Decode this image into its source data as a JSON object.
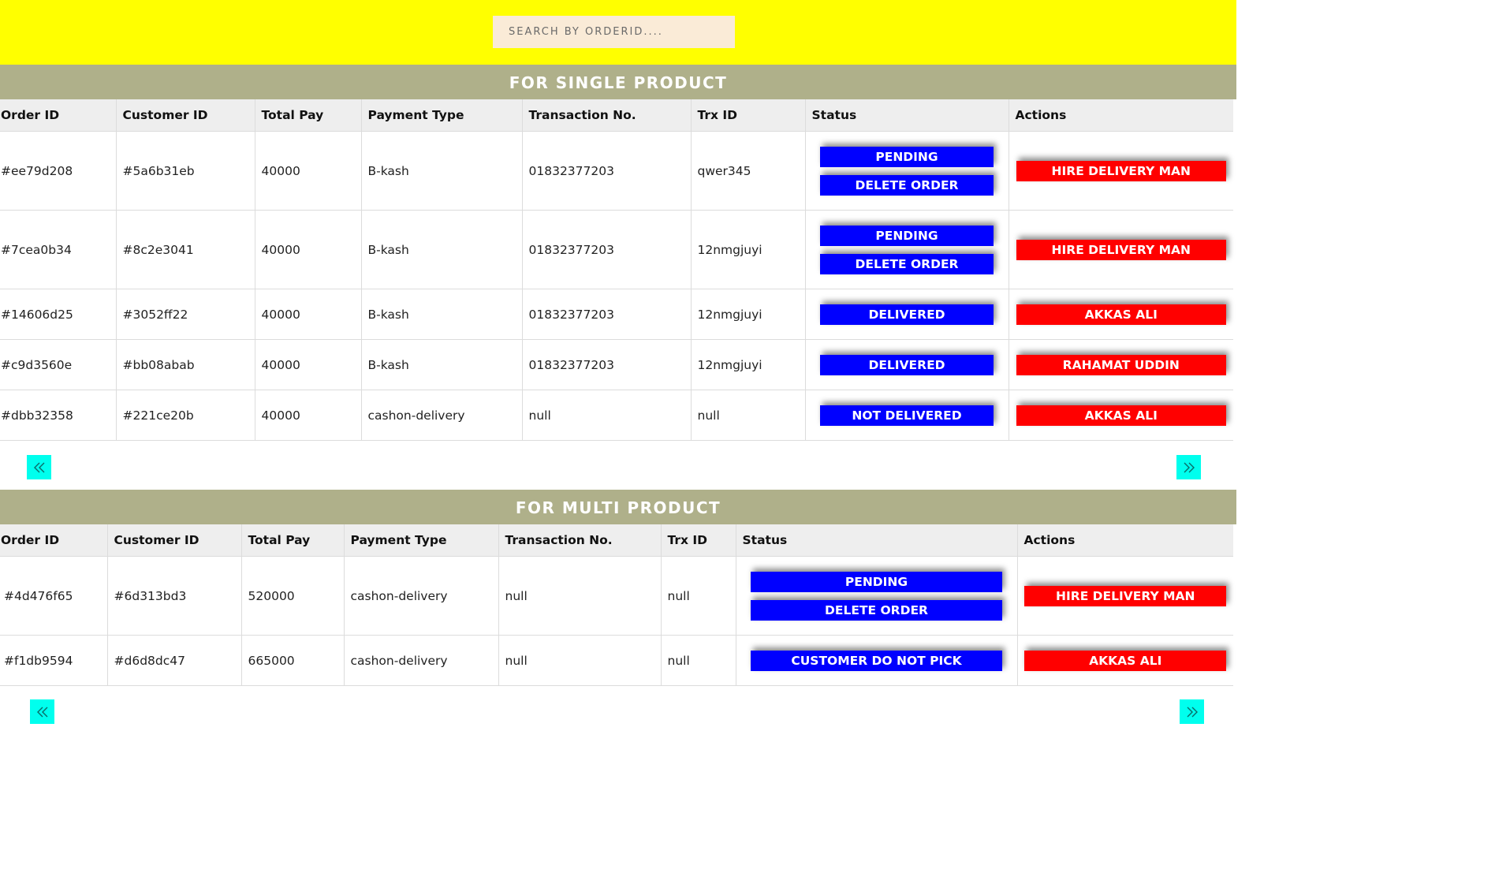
{
  "search": {
    "placeholder": "SEARCH BY ORDERID...."
  },
  "headers": [
    "Order ID",
    "Customer ID",
    "Total Pay",
    "Payment Type",
    "Transaction No.",
    "Trx ID",
    "Status",
    "Actions"
  ],
  "single": {
    "title": "FOR SINGLE PRODUCT",
    "rows": [
      {
        "order_id": "#ee79d208",
        "customer_id": "#5a6b31eb",
        "total_pay": "40000",
        "payment_type": "B-kash",
        "transaction_no": "01832377203",
        "trx_id": "qwer345",
        "status": "PENDING",
        "delete": "DELETE ORDER",
        "action": "HIRE DELIVERY MAN"
      },
      {
        "order_id": "#7cea0b34",
        "customer_id": "#8c2e3041",
        "total_pay": "40000",
        "payment_type": "B-kash",
        "transaction_no": "01832377203",
        "trx_id": "12nmgjuyi",
        "status": "PENDING",
        "delete": "DELETE ORDER",
        "action": "HIRE DELIVERY MAN"
      },
      {
        "order_id": "#14606d25",
        "customer_id": "#3052ff22",
        "total_pay": "40000",
        "payment_type": "B-kash",
        "transaction_no": "01832377203",
        "trx_id": "12nmgjuyi",
        "status": "DELIVERED",
        "action": "AKKAS ALI"
      },
      {
        "order_id": "#c9d3560e",
        "customer_id": "#bb08abab",
        "total_pay": "40000",
        "payment_type": "B-kash",
        "transaction_no": "01832377203",
        "trx_id": "12nmgjuyi",
        "status": "DELIVERED",
        "action": "RAHAMAT UDDIN"
      },
      {
        "order_id": "#dbb32358",
        "customer_id": "#221ce20b",
        "total_pay": "40000",
        "payment_type": "cashon-delivery",
        "transaction_no": "null",
        "trx_id": "null",
        "status": "NOT DELIVERED",
        "action": "AKKAS ALI"
      }
    ]
  },
  "multi": {
    "title": "FOR MULTI PRODUCT",
    "rows": [
      {
        "order_id": "#4d476f65",
        "customer_id": "#6d313bd3",
        "total_pay": "520000",
        "payment_type": "cashon-delivery",
        "transaction_no": "null",
        "trx_id": "null",
        "status": "PENDING",
        "delete": "DELETE ORDER",
        "action": "HIRE DELIVERY MAN"
      },
      {
        "order_id": "#f1db9594",
        "customer_id": "#d6d8dc47",
        "total_pay": "665000",
        "payment_type": "cashon-delivery",
        "transaction_no": "null",
        "trx_id": "null",
        "status": "CUSTOMER DO NOT PICK",
        "action": "AKKAS ALI"
      }
    ]
  },
  "colors": {
    "topbar": "#ffff00",
    "section": "#afb08a",
    "status_button": "#0000ff",
    "action_button": "#ff0000",
    "pager": "#00ffee"
  },
  "icons": {
    "prev": "double-chevron-left-icon",
    "next": "double-chevron-right-icon"
  }
}
